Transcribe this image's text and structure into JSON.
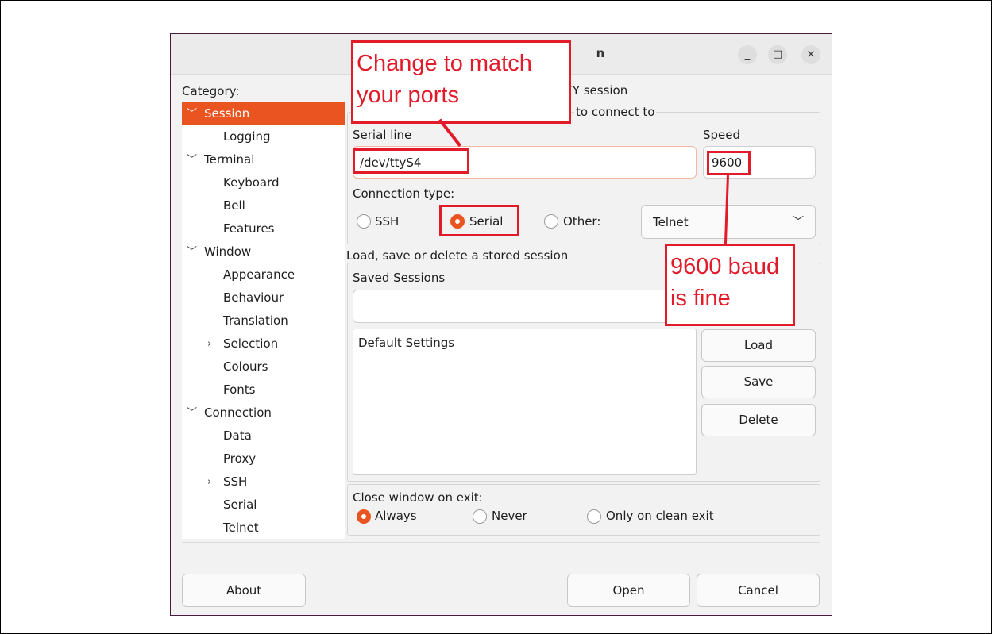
{
  "window": {
    "title": "PuTTY Configuration",
    "title_visible": "n",
    "controls": [
      "_",
      "□",
      "×"
    ]
  },
  "category": {
    "label": "Category:",
    "items": [
      {
        "label": "Session",
        "level": 0,
        "expanded": true,
        "selected": true
      },
      {
        "label": "Logging",
        "level": 1
      },
      {
        "label": "Terminal",
        "level": 0,
        "expanded": true
      },
      {
        "label": "Keyboard",
        "level": 1
      },
      {
        "label": "Bell",
        "level": 1
      },
      {
        "label": "Features",
        "level": 1
      },
      {
        "label": "Window",
        "level": 0,
        "expanded": true
      },
      {
        "label": "Appearance",
        "level": 1
      },
      {
        "label": "Behaviour",
        "level": 1
      },
      {
        "label": "Translation",
        "level": 1
      },
      {
        "label": "Selection",
        "level": 1,
        "collapsed": true
      },
      {
        "label": "Colours",
        "level": 1
      },
      {
        "label": "Fonts",
        "level": 1
      },
      {
        "label": "Connection",
        "level": 0,
        "expanded": true
      },
      {
        "label": "Data",
        "level": 1
      },
      {
        "label": "Proxy",
        "level": 1
      },
      {
        "label": "SSH",
        "level": 1,
        "collapsed": true
      },
      {
        "label": "Serial",
        "level": 1
      },
      {
        "label": "Telnet",
        "level": 1
      }
    ]
  },
  "session": {
    "header_partial": "r your PuTTY session",
    "destination_partial": "to connect to",
    "serial_line_label": "Serial line",
    "serial_line_value": "/dev/ttyS4",
    "speed_label": "Speed",
    "speed_value": "9600",
    "connection_type_label": "Connection type:",
    "connection_types": [
      {
        "label": "SSH",
        "checked": false
      },
      {
        "label": "Serial",
        "checked": true
      },
      {
        "label": "Other:",
        "checked": false
      }
    ],
    "other_protocol": "Telnet",
    "stored_group_label": "Load, save or delete a stored session",
    "saved_sessions_label": "Saved Sessions",
    "saved_sessions_input": "",
    "sessions_list": [
      "Default Settings"
    ],
    "load_button": "Load",
    "save_button": "Save",
    "delete_button": "Delete",
    "close_on_exit_label": "Close window on exit:",
    "close_options": [
      {
        "label": "Always",
        "checked": true
      },
      {
        "label": "Never",
        "checked": false
      },
      {
        "label": "Only on clean exit",
        "checked": false
      }
    ]
  },
  "footer": {
    "about_button": "About",
    "open_button": "Open",
    "cancel_button": "Cancel"
  },
  "annotations": {
    "callout_ports_line1": "Change to match",
    "callout_ports_line2": "your ports",
    "callout_baud_line1": "9600 baud",
    "callout_baud_line2": "is fine",
    "color": "#e21b2b"
  },
  "accent_color": "#e95420"
}
